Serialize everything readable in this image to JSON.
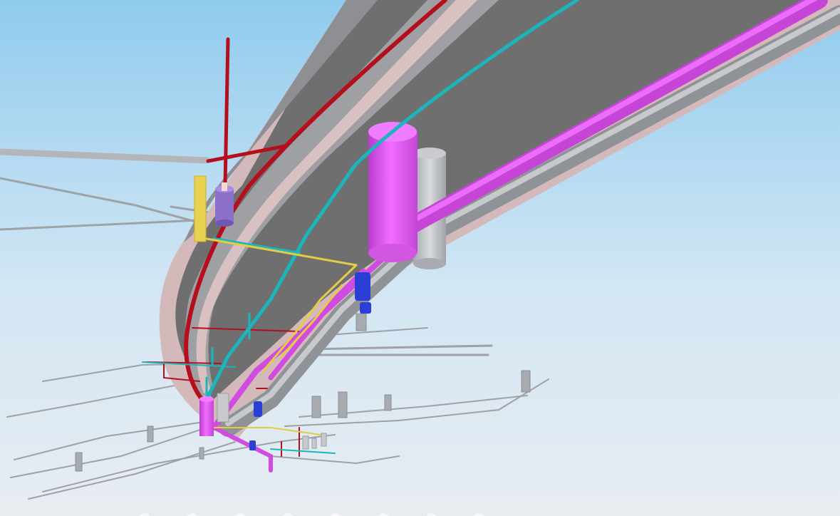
{
  "viewer": {
    "sky_top": "#8fcbee",
    "sky_bottom": "#e6ebf1"
  },
  "colors": {
    "tunnel_dark": "#6e6e6e",
    "tunnel_mid": "#8a8c90",
    "tunnel_lining": "#d7bcbd",
    "pipe_red": "#b80f1e",
    "pipe_cyan": "#1bb8bd",
    "pipe_magenta": "#d94be8",
    "pipe_magenta_light": "#f07cff",
    "pipe_grey": "#a8abb0",
    "pipe_yellow": "#e7cf4b",
    "valve_blue": "#2b3fd6",
    "tank_purple": "#8a70c8"
  },
  "icons": [
    "nav-dot-icon"
  ],
  "nav_dot_count": 8
}
